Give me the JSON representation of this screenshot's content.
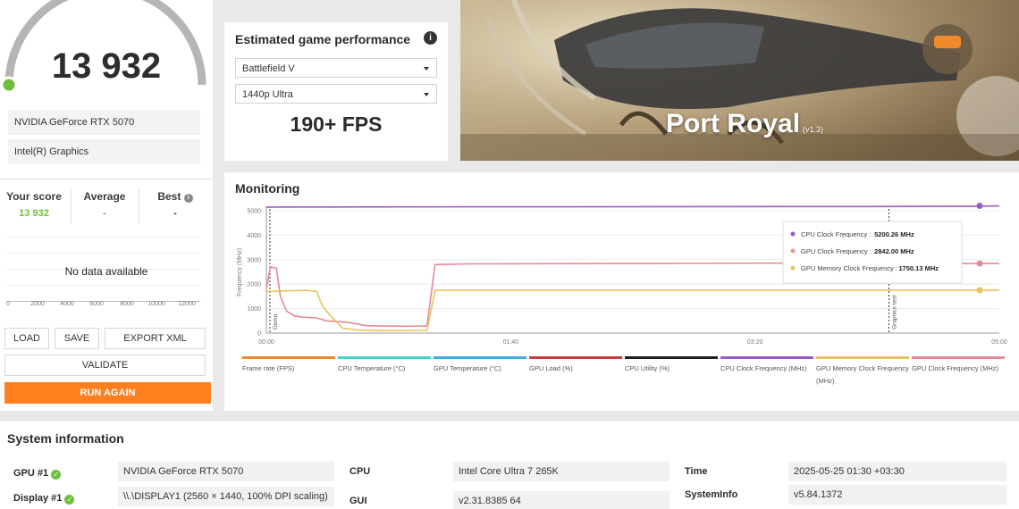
{
  "score": {
    "value": "13 932",
    "gpu": "NVIDIA GeForce RTX 5070",
    "secondary_gpu": "Intel(R) Graphics",
    "gauge_fraction": 0.2
  },
  "comparison": {
    "your_score_label": "Your score",
    "your_score_value": "13 932",
    "average_label": "Average",
    "average_value": "-",
    "best_label": "Best",
    "best_value": "-",
    "no_data": "No data available",
    "ticks": [
      "0",
      "2000",
      "4000",
      "6000",
      "8000",
      "10000",
      "12000"
    ]
  },
  "actions": {
    "load": "LOAD",
    "save": "SAVE",
    "export": "EXPORT XML",
    "validate": "VALIDATE",
    "run_again": "RUN AGAIN"
  },
  "estimated": {
    "title": "Estimated game performance",
    "game": "Battlefield V",
    "preset": "1440p Ultra",
    "fps": "190+ FPS"
  },
  "benchmark": {
    "name": "Port Royal",
    "version": "(v1.3)"
  },
  "monitoring": {
    "title": "Monitoring",
    "chart_data": {
      "type": "line",
      "ylabel": "Frequency (MHz)",
      "ylim": [
        0,
        5000
      ],
      "yticks": [
        "0",
        "1000",
        "2000",
        "3000",
        "4000",
        "5000"
      ],
      "x_ticks": [
        "00:00",
        "01:40",
        "03:20",
        "05:00"
      ],
      "markers": [
        {
          "label": "Demo",
          "time_s": 0
        },
        {
          "label": "Graphics test",
          "time_s": 310
        }
      ],
      "tooltip": [
        {
          "label": "CPU Clock Frequency",
          "value": "5200.26 MHz",
          "color": "#9b59c9"
        },
        {
          "label": "GPU Clock Frequency",
          "value": "2842.00 MHz",
          "color": "#e79b8f"
        },
        {
          "label": "GPU Memory Clock Frequency",
          "value": "1750.13 MHz",
          "color": "#e8c35c"
        }
      ],
      "series": [
        {
          "name": "CPU Clock Frequency",
          "color": "#9b59c9",
          "points": [
            [
              0,
              5150
            ],
            [
              100,
              5160
            ],
            [
              300,
              5170
            ],
            [
              353,
              5180
            ],
            [
              365,
              5200
            ]
          ]
        },
        {
          "name": "GPU Clock Frequency",
          "color": "#e48a98",
          "points": [
            [
              0,
              1800
            ],
            [
              2,
              2700
            ],
            [
              5,
              2650
            ],
            [
              7,
              1500
            ],
            [
              10,
              900
            ],
            [
              14,
              700
            ],
            [
              18,
              650
            ],
            [
              25,
              620
            ],
            [
              30,
              500
            ],
            [
              40,
              450
            ],
            [
              50,
              300
            ],
            [
              60,
              290
            ],
            [
              70,
              280
            ],
            [
              80,
              290
            ],
            [
              84,
              2800
            ],
            [
              100,
              2830
            ],
            [
              200,
              2850
            ],
            [
              300,
              2860
            ],
            [
              310,
              2840
            ],
            [
              365,
              2842
            ]
          ]
        },
        {
          "name": "GPU Memory Clock Frequency",
          "color": "#e8c35c",
          "points": [
            [
              0,
              1700
            ],
            [
              20,
              1750
            ],
            [
              25,
              1700
            ],
            [
              28,
              1100
            ],
            [
              32,
              700
            ],
            [
              38,
              200
            ],
            [
              46,
              120
            ],
            [
              60,
              100
            ],
            [
              80,
              110
            ],
            [
              84,
              1750
            ],
            [
              365,
              1750
            ]
          ]
        }
      ]
    },
    "legend": [
      {
        "label": "Frame rate (FPS)",
        "color": "#f28a2d"
      },
      {
        "label": "CPU Temperature (°C)",
        "color": "#45d6c2"
      },
      {
        "label": "GPU Temperature (°C)",
        "color": "#3aaee0"
      },
      {
        "label": "GPU Load (%)",
        "color": "#c93b3b"
      },
      {
        "label": "CPU Utility (%)",
        "color": "#1f1f1f"
      },
      {
        "label": "CPU Clock Frequency (MHz)",
        "color": "#9b59c9"
      },
      {
        "label": "GPU Memory Clock Frequency (MHz)",
        "color": "#e8c35c"
      },
      {
        "label": "GPU Clock Frequency (MHz)",
        "color": "#e48a98"
      }
    ]
  },
  "system_info": {
    "title": "System information",
    "gpu_label": "GPU #1",
    "gpu_value": "NVIDIA GeForce RTX 5070",
    "display_label": "Display #1",
    "display_value": "\\\\.\\DISPLAY1 (2560 × 1440, 100% DPI scaling)",
    "cpu_label": "CPU",
    "cpu_value": "Intel Core Ultra 7 265K",
    "gui_label": "GUI",
    "gui_value": "v2.31.8385 64",
    "time_label": "Time",
    "time_value": "2025-05-25 01:30 +03:30",
    "sysinfo_label": "SystemInfo",
    "sysinfo_value": "v5.84.1372"
  },
  "colors": {
    "accent": "#ff7f1f",
    "score_green": "#6fbf3a"
  }
}
